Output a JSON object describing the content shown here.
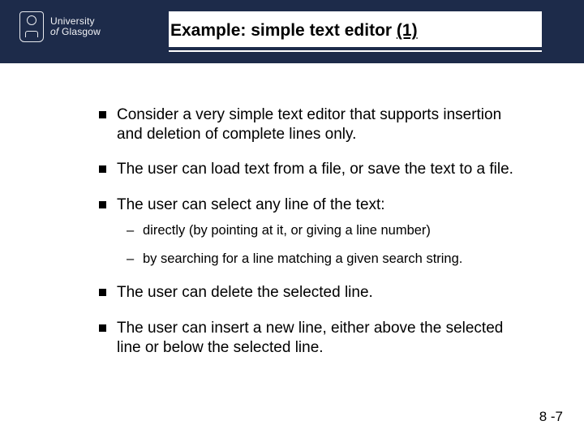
{
  "logo": {
    "line1": "University",
    "line2_prefix": "of ",
    "line2_name": "Glasgow"
  },
  "title": {
    "prefix": "Example: simple text editor ",
    "suffix_underlined": "(1)"
  },
  "bullets": [
    "Consider a very simple text editor that supports insertion and deletion of complete lines only.",
    "The user can load text from a file, or save the text to a file.",
    "The user can select any line of the text:",
    "The user can delete the selected line.",
    "The user can insert a new line, either above the selected line or below the selected line."
  ],
  "sub_bullets": [
    "directly (by pointing at it, or giving a line number)",
    "by searching for a line matching a given search string."
  ],
  "page_number": "8 -7"
}
